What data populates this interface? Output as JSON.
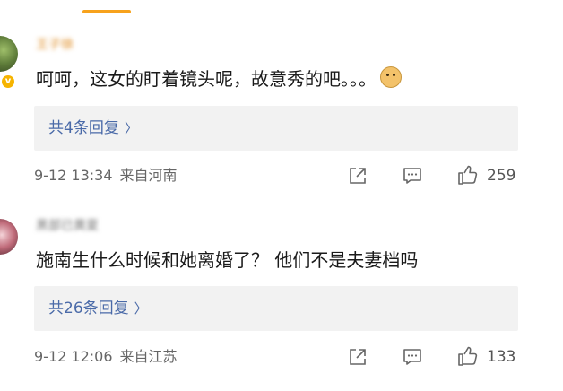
{
  "comments": [
    {
      "username": "王子徐",
      "content": "呵呵，这女的盯着镜头呢，故意秀的吧。。。",
      "emoji": "doge-emoji",
      "replies_label": "共4条回复",
      "date": "9-12 13:34",
      "source": "来自河南",
      "likes": "259"
    },
    {
      "username": "黑部已黄夏",
      "content": "施南生什么时候和她离婚了？ 他们不是夫妻档吗",
      "replies_label": "共26条回复",
      "date": "9-12 12:06",
      "source": "来自江苏",
      "likes": "133"
    }
  ],
  "icons": [
    "share-icon",
    "comment-icon",
    "like-icon",
    "verified-badge-icon",
    "chevron-right-icon"
  ],
  "colors": {
    "accent": "#f7a21c",
    "link": "#4a6aa8",
    "reply_bg": "#f2f2f2"
  }
}
